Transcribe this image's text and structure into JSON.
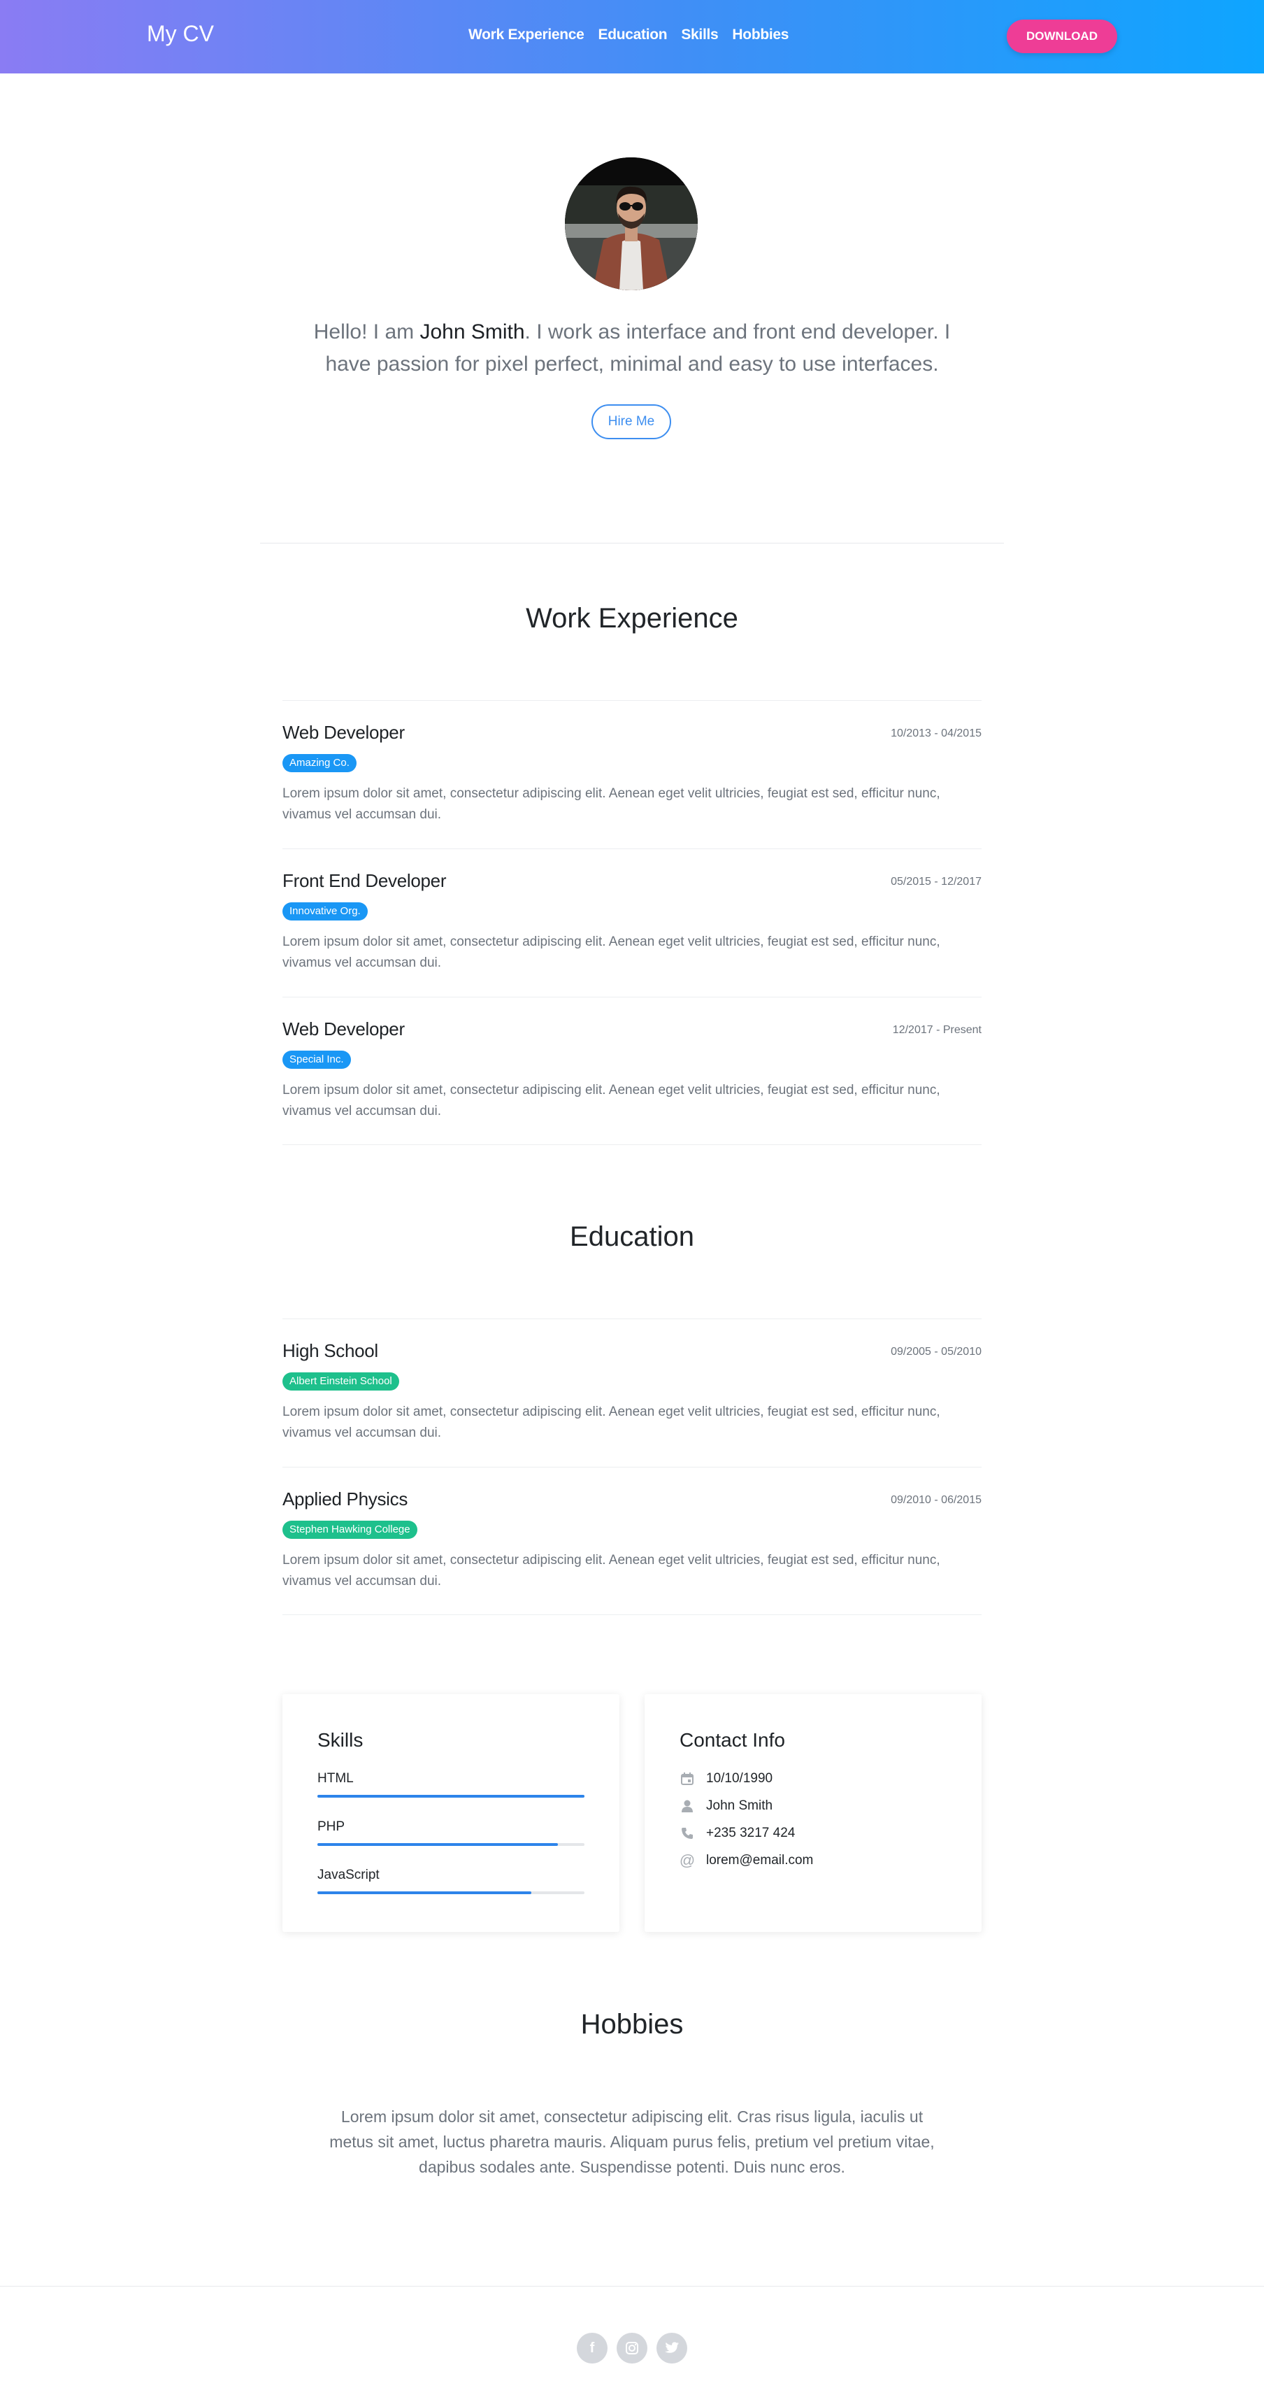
{
  "nav": {
    "brand": "My CV",
    "links": [
      "Work Experience",
      "Education",
      "Skills",
      "Hobbies"
    ],
    "download_label": "DOWNLOAD"
  },
  "hero": {
    "intro_prefix": "Hello! I am ",
    "name": "John Smith",
    "intro_suffix": ". I work as interface and front end developer. I have passion for pixel perfect, minimal and easy to use interfaces.",
    "hire_label": "Hire Me"
  },
  "work": {
    "title": "Work Experience",
    "items": [
      {
        "role": "Web Developer",
        "company": "Amazing Co.",
        "date": "10/2013 - 04/2015",
        "text": "Lorem ipsum dolor sit amet, consectetur adipiscing elit. Aenean eget velit ultricies, feugiat est sed, efficitur nunc, vivamus vel accumsan dui."
      },
      {
        "role": "Front End Developer",
        "company": "Innovative Org.",
        "date": "05/2015 - 12/2017",
        "text": "Lorem ipsum dolor sit amet, consectetur adipiscing elit. Aenean eget velit ultricies, feugiat est sed, efficitur nunc, vivamus vel accumsan dui."
      },
      {
        "role": "Web Developer",
        "company": "Special Inc.",
        "date": "12/2017 - Present",
        "text": "Lorem ipsum dolor sit amet, consectetur adipiscing elit. Aenean eget velit ultricies, feugiat est sed, efficitur nunc, vivamus vel accumsan dui."
      }
    ]
  },
  "education": {
    "title": "Education",
    "items": [
      {
        "role": "High School",
        "company": "Albert Einstein School",
        "date": "09/2005 - 05/2010",
        "text": "Lorem ipsum dolor sit amet, consectetur adipiscing elit. Aenean eget velit ultricies, feugiat est sed, efficitur nunc, vivamus vel accumsan dui."
      },
      {
        "role": "Applied Physics",
        "company": "Stephen Hawking College",
        "date": "09/2010 - 06/2015",
        "text": "Lorem ipsum dolor sit amet, consectetur adipiscing elit. Aenean eget velit ultricies, feugiat est sed, efficitur nunc, vivamus vel accumsan dui."
      }
    ]
  },
  "skills": {
    "title": "Skills",
    "items": [
      {
        "name": "HTML",
        "level": 1.0
      },
      {
        "name": "PHP",
        "level": 0.9
      },
      {
        "name": "JavaScript",
        "level": 0.8
      }
    ]
  },
  "contact": {
    "title": "Contact Info",
    "birthday": "10/10/1990",
    "name": "John Smith",
    "phone": "+235 3217 424",
    "email": "lorem@email.com"
  },
  "hobbies": {
    "title": "Hobbies",
    "text": "Lorem ipsum dolor sit amet, consectetur adipiscing elit. Cras risus ligula, iaculis ut metus sit amet, luctus pharetra mauris. Aliquam purus felis, pretium vel pretium vitae, dapibus sodales ante. Suspendisse potenti. Duis nunc eros."
  },
  "social": {
    "icons": [
      "facebook-icon",
      "instagram-icon",
      "twitter-icon"
    ],
    "facebook_glyph": "f"
  },
  "colors": {
    "accent_blue": "#1a97f5",
    "accent_green": "#1ec08c",
    "download_pink": "#ee3d96"
  }
}
